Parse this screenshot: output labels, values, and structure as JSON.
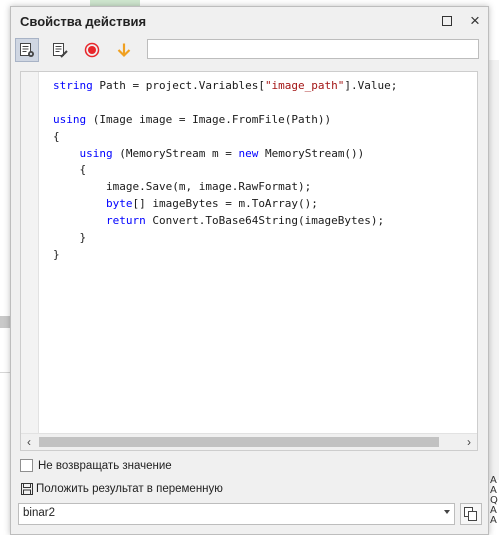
{
  "window": {
    "title": "Свойства действия"
  },
  "toolbar": {
    "search_value": ""
  },
  "editor": {
    "lines": [
      [
        {
          "t": "string",
          "c": "kw"
        },
        {
          "t": " Path = project.Variables[",
          "c": ""
        },
        {
          "t": "\"image_path\"",
          "c": "str"
        },
        {
          "t": "].Value;",
          "c": ""
        }
      ],
      [],
      [
        {
          "t": "using",
          "c": "kw"
        },
        {
          "t": " (Image image = Image.FromFile(Path))",
          "c": ""
        }
      ],
      [
        {
          "t": "{",
          "c": ""
        }
      ],
      [
        {
          "t": "    ",
          "c": ""
        },
        {
          "t": "using",
          "c": "kw"
        },
        {
          "t": " (MemoryStream m = ",
          "c": ""
        },
        {
          "t": "new",
          "c": "kw"
        },
        {
          "t": " MemoryStream())",
          "c": ""
        }
      ],
      [
        {
          "t": "    {",
          "c": ""
        }
      ],
      [
        {
          "t": "        image.Save(m, image.RawFormat);",
          "c": ""
        }
      ],
      [
        {
          "t": "        ",
          "c": ""
        },
        {
          "t": "byte",
          "c": "kw"
        },
        {
          "t": "[] imageBytes = m.ToArray();",
          "c": ""
        }
      ],
      [
        {
          "t": "        ",
          "c": ""
        },
        {
          "t": "return",
          "c": "kw"
        },
        {
          "t": " Convert.ToBase64String(imageBytes);",
          "c": ""
        }
      ],
      [
        {
          "t": "    }",
          "c": ""
        }
      ],
      [
        {
          "t": "}",
          "c": ""
        }
      ]
    ]
  },
  "options": {
    "no_return_label": "Не возвращать значение",
    "no_return_checked": false,
    "save_result_label": "Положить результат в переменную",
    "variable_value": "binar2"
  },
  "colors": {
    "keyword": "#0000ff",
    "string": "#a31515",
    "record": "#e8262b",
    "arrow": "#f0a020"
  },
  "background": {
    "right_letters": [
      "A",
      "A",
      "Q",
      "A",
      "A"
    ]
  }
}
